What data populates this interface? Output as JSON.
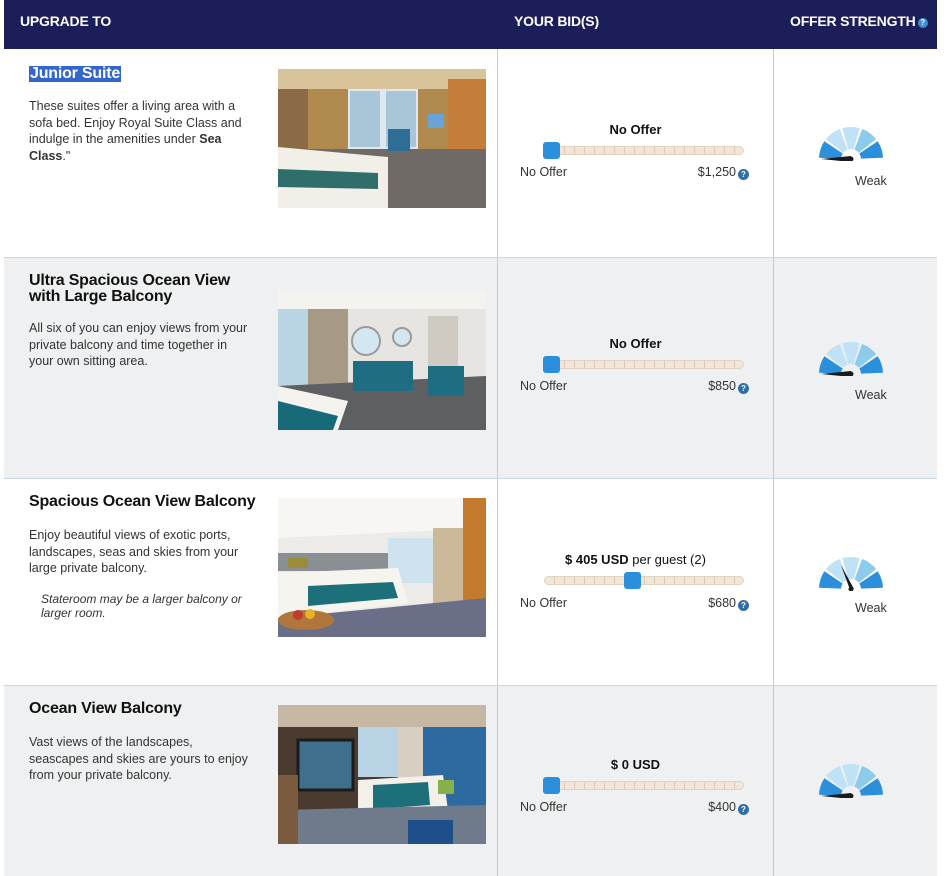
{
  "header": {
    "upgrade_to": "UPGRADE TO",
    "your_bids": "YOUR BID(S)",
    "offer_strength": "OFFER STRENGTH",
    "help_glyph": "?"
  },
  "rooms": [
    {
      "title": "Junior Suite",
      "description_pre": "These suites offer a living area with a sofa bed. Enjoy Royal Suite Class and indulge in the amenities under ",
      "description_bold": "Sea Class",
      "description_post": ".\"",
      "note": "",
      "bid_label_bold": "No Offer",
      "bid_label_rest": "",
      "min_label": "No Offer",
      "max_label": "$1,250",
      "slider_fraction": 0,
      "strength": "Weak",
      "needle": "left"
    },
    {
      "title": "Ultra Spacious Ocean View with Large Balcony",
      "description_pre": "All six of you can enjoy views from your private balcony and time together in your own sitting area.",
      "description_bold": "",
      "description_post": "",
      "note": "",
      "bid_label_bold": "No Offer",
      "bid_label_rest": "",
      "min_label": "No Offer",
      "max_label": "$850",
      "slider_fraction": 0,
      "strength": "Weak",
      "needle": "left"
    },
    {
      "title": "Spacious Ocean View Balcony",
      "description_pre": "Enjoy beautiful views of exotic ports, landscapes, seas and skies from your large private balcony.",
      "description_bold": "",
      "description_post": "",
      "note": "Stateroom may be a larger balcony or larger room.",
      "bid_label_bold": "$ 405 USD",
      "bid_label_rest": " per guest (2)",
      "min_label": "No Offer",
      "max_label": "$680",
      "slider_fraction": 0.44,
      "strength": "Weak",
      "needle": "up"
    },
    {
      "title": "Ocean View Balcony",
      "description_pre": "Vast views of the landscapes, seascapes and skies are yours to enjoy from your private balcony.",
      "description_bold": "",
      "description_post": "",
      "note": "",
      "bid_label_bold": "$ 0 USD",
      "bid_label_rest": "",
      "min_label": "No Offer",
      "max_label": "$400",
      "slider_fraction": 0,
      "strength": "",
      "needle": "left"
    }
  ],
  "colors": {
    "header_bg": "#1c1e5a",
    "slider_thumb": "#2b8fdc",
    "gauge_dark": "#2b8fdc",
    "gauge_light": "#bfe2f6"
  }
}
